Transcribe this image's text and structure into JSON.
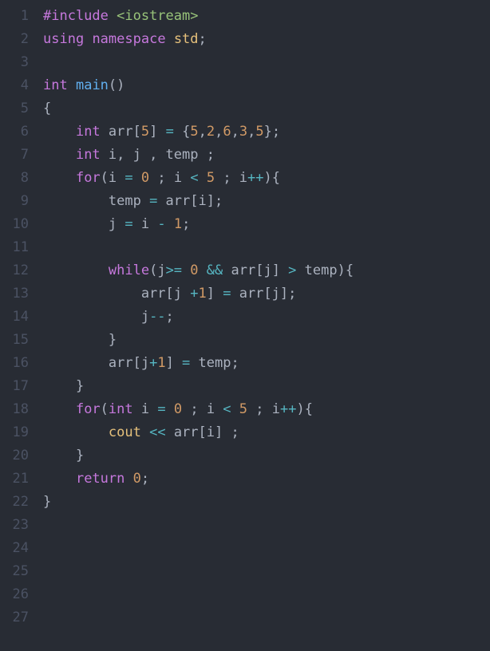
{
  "editor": {
    "lineNumbers": [
      "1",
      "2",
      "3",
      "4",
      "5",
      "6",
      "7",
      "8",
      "9",
      "10",
      "11",
      "12",
      "13",
      "14",
      "15",
      "16",
      "17",
      "18",
      "19",
      "20",
      "21",
      "22",
      "23",
      "24",
      "25",
      "26",
      "27"
    ],
    "tokens": [
      [
        {
          "t": "#include ",
          "c": "tok-pre"
        },
        {
          "t": "<iostream>",
          "c": "tok-str"
        }
      ],
      [
        {
          "t": "using",
          "c": "tok-kw"
        },
        {
          "t": " ",
          "c": "tok-punc"
        },
        {
          "t": "namespace",
          "c": "tok-kw"
        },
        {
          "t": " ",
          "c": "tok-punc"
        },
        {
          "t": "std",
          "c": "tok-ns"
        },
        {
          "t": ";",
          "c": "tok-punc"
        }
      ],
      [],
      [
        {
          "t": "int",
          "c": "tok-type"
        },
        {
          "t": " ",
          "c": "tok-punc"
        },
        {
          "t": "main",
          "c": "tok-func"
        },
        {
          "t": "()",
          "c": "tok-punc"
        }
      ],
      [
        {
          "t": "{",
          "c": "tok-punc"
        }
      ],
      [
        {
          "t": "    ",
          "c": "tok-punc"
        },
        {
          "t": "int",
          "c": "tok-type"
        },
        {
          "t": " arr[",
          "c": "tok-punc"
        },
        {
          "t": "5",
          "c": "tok-num"
        },
        {
          "t": "] ",
          "c": "tok-punc"
        },
        {
          "t": "=",
          "c": "tok-op"
        },
        {
          "t": " {",
          "c": "tok-punc"
        },
        {
          "t": "5",
          "c": "tok-num"
        },
        {
          "t": ",",
          "c": "tok-punc"
        },
        {
          "t": "2",
          "c": "tok-num"
        },
        {
          "t": ",",
          "c": "tok-punc"
        },
        {
          "t": "6",
          "c": "tok-num"
        },
        {
          "t": ",",
          "c": "tok-punc"
        },
        {
          "t": "3",
          "c": "tok-num"
        },
        {
          "t": ",",
          "c": "tok-punc"
        },
        {
          "t": "5",
          "c": "tok-num"
        },
        {
          "t": "};",
          "c": "tok-punc"
        }
      ],
      [
        {
          "t": "    ",
          "c": "tok-punc"
        },
        {
          "t": "int",
          "c": "tok-type"
        },
        {
          "t": " i, j , temp ;",
          "c": "tok-punc"
        }
      ],
      [
        {
          "t": "    ",
          "c": "tok-punc"
        },
        {
          "t": "for",
          "c": "tok-kw"
        },
        {
          "t": "(i ",
          "c": "tok-punc"
        },
        {
          "t": "=",
          "c": "tok-op"
        },
        {
          "t": " ",
          "c": "tok-punc"
        },
        {
          "t": "0",
          "c": "tok-num"
        },
        {
          "t": " ; i ",
          "c": "tok-punc"
        },
        {
          "t": "<",
          "c": "tok-op"
        },
        {
          "t": " ",
          "c": "tok-punc"
        },
        {
          "t": "5",
          "c": "tok-num"
        },
        {
          "t": " ; i",
          "c": "tok-punc"
        },
        {
          "t": "++",
          "c": "tok-op"
        },
        {
          "t": "){",
          "c": "tok-punc"
        }
      ],
      [
        {
          "t": "        temp ",
          "c": "tok-punc"
        },
        {
          "t": "=",
          "c": "tok-op"
        },
        {
          "t": " arr[i];",
          "c": "tok-punc"
        }
      ],
      [
        {
          "t": "        j ",
          "c": "tok-punc"
        },
        {
          "t": "=",
          "c": "tok-op"
        },
        {
          "t": " i ",
          "c": "tok-punc"
        },
        {
          "t": "-",
          "c": "tok-op"
        },
        {
          "t": " ",
          "c": "tok-punc"
        },
        {
          "t": "1",
          "c": "tok-num"
        },
        {
          "t": ";",
          "c": "tok-punc"
        }
      ],
      [],
      [
        {
          "t": "        ",
          "c": "tok-punc"
        },
        {
          "t": "while",
          "c": "tok-kw"
        },
        {
          "t": "(j",
          "c": "tok-punc"
        },
        {
          "t": ">=",
          "c": "tok-op"
        },
        {
          "t": " ",
          "c": "tok-punc"
        },
        {
          "t": "0",
          "c": "tok-num"
        },
        {
          "t": " ",
          "c": "tok-punc"
        },
        {
          "t": "&&",
          "c": "tok-op"
        },
        {
          "t": " arr[j] ",
          "c": "tok-punc"
        },
        {
          "t": ">",
          "c": "tok-op"
        },
        {
          "t": " temp){",
          "c": "tok-punc"
        }
      ],
      [
        {
          "t": "            arr[j ",
          "c": "tok-punc"
        },
        {
          "t": "+",
          "c": "tok-op"
        },
        {
          "t": "1",
          "c": "tok-num"
        },
        {
          "t": "] ",
          "c": "tok-punc"
        },
        {
          "t": "=",
          "c": "tok-op"
        },
        {
          "t": " arr[j];",
          "c": "tok-punc"
        }
      ],
      [
        {
          "t": "            j",
          "c": "tok-punc"
        },
        {
          "t": "--",
          "c": "tok-op"
        },
        {
          "t": ";",
          "c": "tok-punc"
        }
      ],
      [
        {
          "t": "        }",
          "c": "tok-punc"
        }
      ],
      [
        {
          "t": "        arr[j",
          "c": "tok-punc"
        },
        {
          "t": "+",
          "c": "tok-op"
        },
        {
          "t": "1",
          "c": "tok-num"
        },
        {
          "t": "] ",
          "c": "tok-punc"
        },
        {
          "t": "=",
          "c": "tok-op"
        },
        {
          "t": " temp;",
          "c": "tok-punc"
        }
      ],
      [
        {
          "t": "    }",
          "c": "tok-punc"
        }
      ],
      [
        {
          "t": "    ",
          "c": "tok-punc"
        },
        {
          "t": "for",
          "c": "tok-kw"
        },
        {
          "t": "(",
          "c": "tok-punc"
        },
        {
          "t": "int",
          "c": "tok-type"
        },
        {
          "t": " i ",
          "c": "tok-punc"
        },
        {
          "t": "=",
          "c": "tok-op"
        },
        {
          "t": " ",
          "c": "tok-punc"
        },
        {
          "t": "0",
          "c": "tok-num"
        },
        {
          "t": " ; i ",
          "c": "tok-punc"
        },
        {
          "t": "<",
          "c": "tok-op"
        },
        {
          "t": " ",
          "c": "tok-punc"
        },
        {
          "t": "5",
          "c": "tok-num"
        },
        {
          "t": " ; i",
          "c": "tok-punc"
        },
        {
          "t": "++",
          "c": "tok-op"
        },
        {
          "t": "){",
          "c": "tok-punc"
        }
      ],
      [
        {
          "t": "        ",
          "c": "tok-punc"
        },
        {
          "t": "cout",
          "c": "tok-stream"
        },
        {
          "t": " ",
          "c": "tok-punc"
        },
        {
          "t": "<<",
          "c": "tok-op"
        },
        {
          "t": " arr[i] ;",
          "c": "tok-punc"
        }
      ],
      [
        {
          "t": "    }",
          "c": "tok-punc"
        }
      ],
      [
        {
          "t": "    ",
          "c": "tok-punc"
        },
        {
          "t": "return",
          "c": "tok-kw"
        },
        {
          "t": " ",
          "c": "tok-punc"
        },
        {
          "t": "0",
          "c": "tok-num"
        },
        {
          "t": ";",
          "c": "tok-punc"
        }
      ],
      [
        {
          "t": "}",
          "c": "tok-punc"
        }
      ],
      [],
      [],
      [],
      [],
      []
    ]
  }
}
